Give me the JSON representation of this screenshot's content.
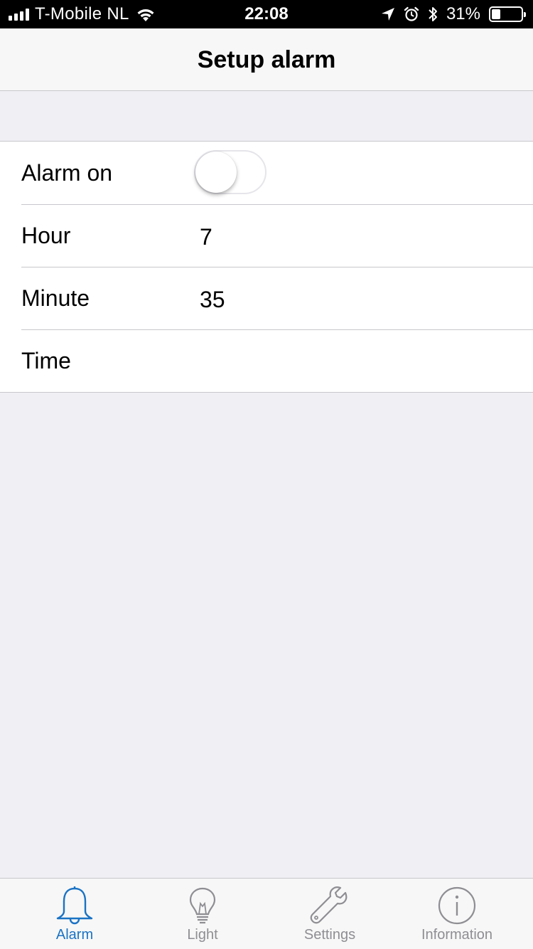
{
  "status_bar": {
    "carrier": "T-Mobile NL",
    "time": "22:08",
    "battery_percent": "31%",
    "battery_level": 0.31
  },
  "nav": {
    "title": "Setup alarm"
  },
  "form": {
    "alarm_on_label": "Alarm on",
    "alarm_on_value": false,
    "hour_label": "Hour",
    "hour_value": "7",
    "minute_label": "Minute",
    "minute_value": "35",
    "time_label": "Time"
  },
  "tabs": [
    {
      "label": "Alarm",
      "icon": "bell-icon",
      "active": true
    },
    {
      "label": "Light",
      "icon": "bulb-icon",
      "active": false
    },
    {
      "label": "Settings",
      "icon": "wrench-icon",
      "active": false
    },
    {
      "label": "Information",
      "icon": "info-icon",
      "active": false
    }
  ],
  "colors": {
    "accent": "#1a73c4",
    "inactive": "#8e8e93",
    "background": "#efeff4"
  }
}
